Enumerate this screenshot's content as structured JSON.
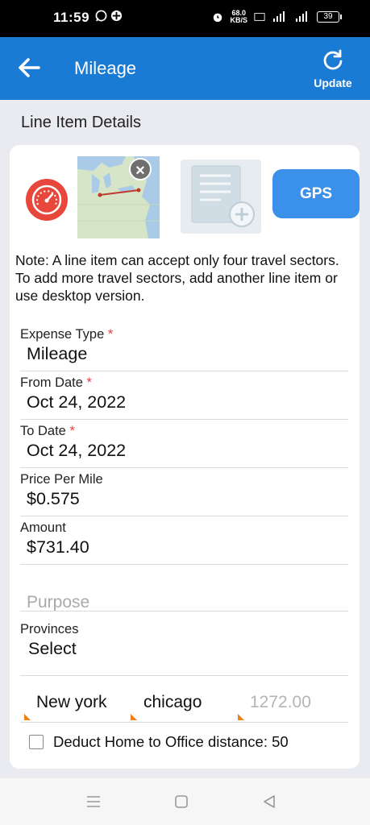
{
  "status": {
    "time": "11:59",
    "net_speed": "68.0",
    "net_unit": "KB/S",
    "battery": "39"
  },
  "appbar": {
    "title": "Mileage",
    "update_label": "Update"
  },
  "section_title": "Line Item Details",
  "gps_label": "GPS",
  "note": "Note: A line item can accept only four travel sectors. To add more travel sectors, add another line item or use desktop version.",
  "fields": {
    "expense_type": {
      "label": "Expense Type",
      "value": "Mileage"
    },
    "from_date": {
      "label": "From Date",
      "value": "Oct 24, 2022"
    },
    "to_date": {
      "label": "To Date",
      "value": "Oct 24, 2022"
    },
    "price_per_mile": {
      "label": "Price Per Mile",
      "value": "$0.575"
    },
    "amount": {
      "label": "Amount",
      "value": "$731.40"
    },
    "purpose_placeholder": "Purpose",
    "provinces": {
      "label": "Provinces",
      "value": "Select"
    }
  },
  "required_marker": "*",
  "sector": {
    "from": "New york",
    "to": "chicago",
    "distance": "1272.00"
  },
  "deduct_label": "Deduct Home to Office distance: 50",
  "deduct_checked": false,
  "colors": {
    "accent": "#1a7bd4",
    "gps": "#3b90ea",
    "required": "#e04040",
    "sector_mark": "#f0811a"
  }
}
